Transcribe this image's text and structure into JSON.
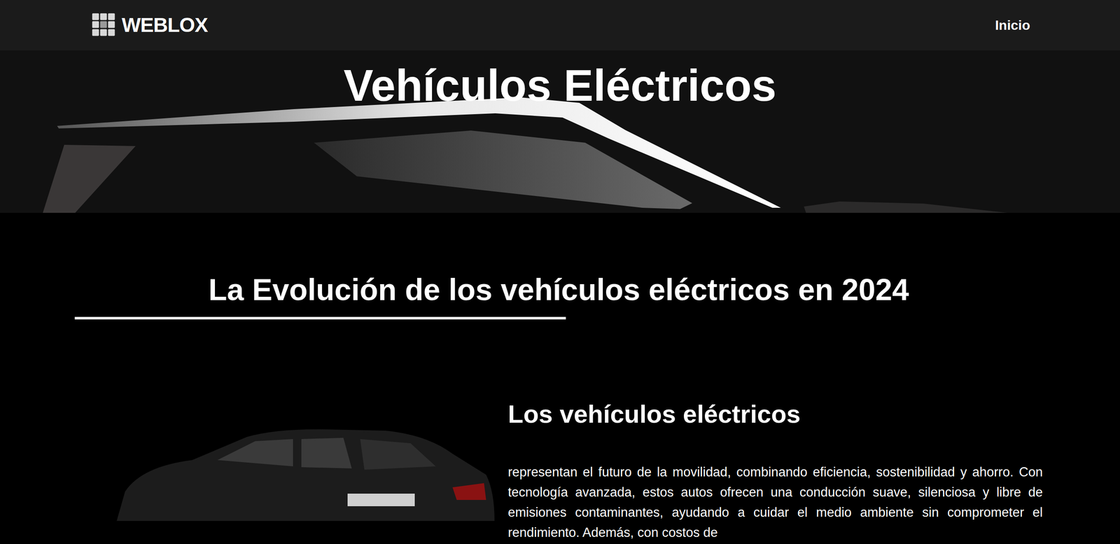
{
  "nav": {
    "logo": "WEBLOX",
    "links": [
      {
        "label": "Inicio"
      }
    ]
  },
  "hero": {
    "title": "Vehículos Eléctricos"
  },
  "section": {
    "heading": "La Evolución de los vehículos eléctricos en 2024"
  },
  "article": {
    "subheading": "Los vehículos eléctricos",
    "paragraph": "representan el futuro de la movilidad, combinando eficiencia, sostenibilidad y ahorro. Con tecnología avanzada, estos autos ofrecen una conducción suave, silenciosa y libre de emisiones contaminantes, ayudando a cuidar el medio ambiente sin comprometer el rendimiento. Además, con costos de"
  }
}
